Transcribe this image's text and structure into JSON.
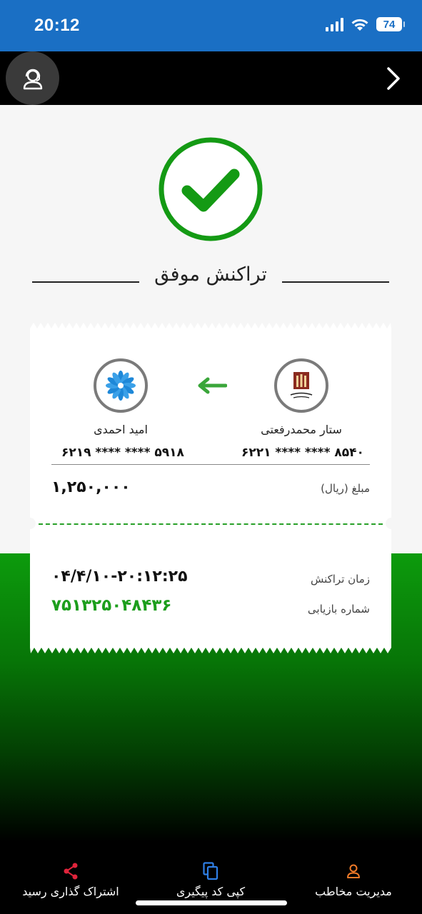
{
  "status_bar": {
    "time": "20:12",
    "battery": "74"
  },
  "colors": {
    "accent_green": "#1c9e1c",
    "status_blue": "#1a6fc4",
    "header_black": "#000000"
  },
  "header": {
    "support_icon": "headset-support-icon",
    "back_icon": "chevron-right-icon"
  },
  "result": {
    "title": "تراکنش موفق",
    "icon": "check-circle-icon"
  },
  "transfer": {
    "from": {
      "bank_icon": "bank-parsian-logo",
      "name": "ستار محمدرفعتی",
      "card_number": "۶۲۲۱ **** **** ۸۵۴۰"
    },
    "to": {
      "bank_icon": "bank-saman-logo",
      "name": "امید احمدی",
      "card_number": "۶۲۱۹ **** **** ۵۹۱۸"
    },
    "arrow_icon": "arrow-left-icon",
    "amount": {
      "label": "مبلغ (ریال)",
      "value": "۱,۲۵۰,۰۰۰"
    }
  },
  "details": {
    "time": {
      "label": "زمان تراکنش",
      "value": "۰۴/۴/۱۰-۲۰:۱۲:۲۵"
    },
    "tracking": {
      "label": "شماره بازیابی",
      "value": "۷۵۱۳۲۵۰۴۸۴۳۶"
    }
  },
  "actions": {
    "share": {
      "label": "اشتراک گذاری رسید",
      "icon": "share-icon"
    },
    "copy": {
      "label": "کپی کد پیگیری",
      "icon": "copy-icon"
    },
    "contact": {
      "label": "مدیریت مخاطب",
      "icon": "person-icon"
    }
  }
}
